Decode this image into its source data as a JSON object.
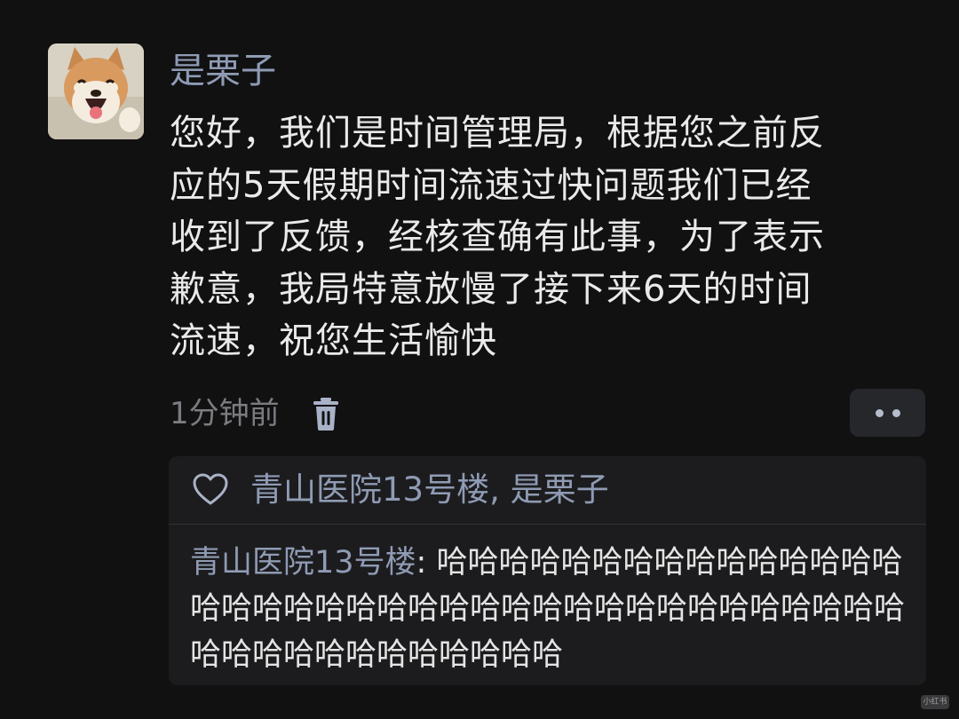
{
  "post": {
    "username": "是栗子",
    "message": "您好，我们是时间管理局，根据您之前反\n应的5天假期时间流速过快问题我们已经\n收到了反馈，经核查确有此事，为了表示\n歉意，我局特意放慢了接下来6天的时间\n流速，祝您生活愉快",
    "time_ago": "1分钟前",
    "avatar_icon": "shiba-dog-avatar",
    "delete_icon": "trash-icon",
    "more_icon": "more-dots-icon"
  },
  "reply_box": {
    "likes_icon": "heart-outline-icon",
    "likes_text": "青山医院13号楼, 是栗子",
    "comment_author": "青山医院13号楼",
    "comment_separator": ": ",
    "comment_text": "哈哈哈哈哈哈哈哈哈哈哈哈哈哈哈哈哈哈哈哈哈哈哈哈哈哈哈哈哈哈哈哈哈哈哈哈哈哈哈哈哈哈哈哈哈哈哈哈哈哈"
  },
  "watermark": {
    "text": "小红书"
  },
  "colors": {
    "background": "#111112",
    "name_accent": "#8f9bb4",
    "body_text": "#eaeaea",
    "muted": "#7b7b80",
    "panel": "#1c1c1e"
  }
}
